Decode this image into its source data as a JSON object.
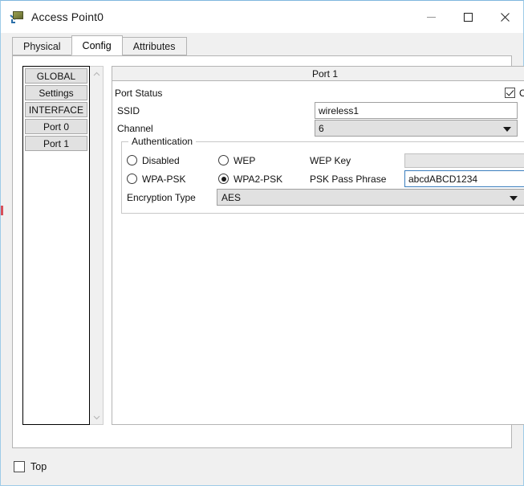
{
  "window": {
    "title": "Access Point0",
    "icon": "access-point-icon",
    "controls": {
      "minimize": "—",
      "maximize": "□",
      "close": "✕"
    }
  },
  "tabs": [
    {
      "label": "Physical",
      "active": false
    },
    {
      "label": "Config",
      "active": true
    },
    {
      "label": "Attributes",
      "active": false
    }
  ],
  "sidebar": {
    "items": [
      {
        "label": "GLOBAL",
        "type": "header"
      },
      {
        "label": "Settings",
        "type": "item"
      },
      {
        "label": "INTERFACE",
        "type": "header"
      },
      {
        "label": "Port 0",
        "type": "item"
      },
      {
        "label": "Port 1",
        "type": "item"
      }
    ],
    "scroll_up": "⌃",
    "scroll_down": "⌄"
  },
  "main": {
    "panel_title": "Port 1",
    "port_status": {
      "label": "Port Status",
      "checkbox_label": "On",
      "checked": true
    },
    "ssid": {
      "label": "SSID",
      "value": "wireless1"
    },
    "channel": {
      "label": "Channel",
      "value": "6"
    },
    "authentication": {
      "group_label": "Authentication",
      "options": [
        {
          "label": "Disabled",
          "selected": false
        },
        {
          "label": "WEP",
          "selected": false
        },
        {
          "label": "WPA-PSK",
          "selected": false
        },
        {
          "label": "WPA2-PSK",
          "selected": true
        }
      ],
      "wep_key": {
        "label": "WEP Key",
        "value": "",
        "enabled": false
      },
      "psk_pass_phrase": {
        "label": "PSK Pass Phrase",
        "value": "abcdABCD1234",
        "focused": true
      },
      "encryption_type": {
        "label": "Encryption Type",
        "value": "AES"
      }
    }
  },
  "footer": {
    "top_checkbox": {
      "label": "Top",
      "checked": false
    }
  },
  "colors": {
    "window_border": "#9ecbe8",
    "focus_border": "#3a7dbd",
    "control_face": "#f0f0f0",
    "combo_face": "#e1e1e1",
    "disabled_face": "#e6e6e6"
  }
}
